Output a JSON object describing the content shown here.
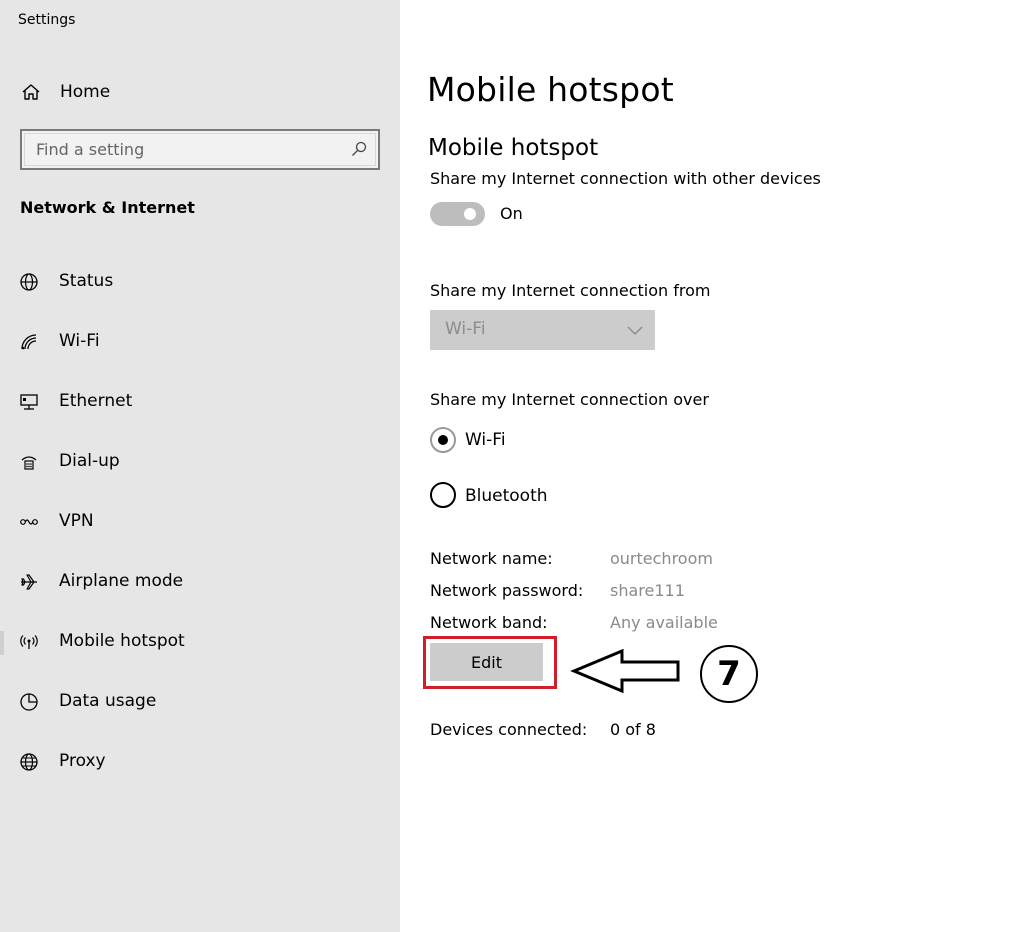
{
  "window": {
    "title": "Settings"
  },
  "sidebar": {
    "home_label": "Home",
    "search_placeholder": "Find a setting",
    "section_title": "Network & Internet",
    "items": [
      {
        "label": "Status",
        "icon": "globe-status-icon"
      },
      {
        "label": "Wi-Fi",
        "icon": "wifi-icon"
      },
      {
        "label": "Ethernet",
        "icon": "ethernet-icon"
      },
      {
        "label": "Dial-up",
        "icon": "dialup-icon"
      },
      {
        "label": "VPN",
        "icon": "vpn-icon"
      },
      {
        "label": "Airplane mode",
        "icon": "airplane-icon"
      },
      {
        "label": "Mobile hotspot",
        "icon": "hotspot-icon",
        "selected": true
      },
      {
        "label": "Data usage",
        "icon": "pie-chart-icon"
      },
      {
        "label": "Proxy",
        "icon": "globe-icon"
      }
    ]
  },
  "main": {
    "page_title": "Mobile hotspot",
    "section_title": "Mobile hotspot",
    "share_label": "Share my Internet connection with other devices",
    "toggle_state": "On",
    "share_from_label": "Share my Internet connection from",
    "share_from_value": "Wi-Fi",
    "share_over_label": "Share my Internet connection over",
    "share_over_options": [
      {
        "label": "Wi-Fi",
        "checked": true
      },
      {
        "label": "Bluetooth",
        "checked": false
      }
    ],
    "network": {
      "name_label": "Network name:",
      "name_value": "ourtechroom",
      "password_label": "Network password:",
      "password_value": "share111",
      "band_label": "Network band:",
      "band_value": "Any available"
    },
    "edit_label": "Edit",
    "devices_label": "Devices connected:",
    "devices_value": "0 of 8"
  },
  "annotation": {
    "step_number": "7",
    "highlight_color": "#d21e2b"
  }
}
